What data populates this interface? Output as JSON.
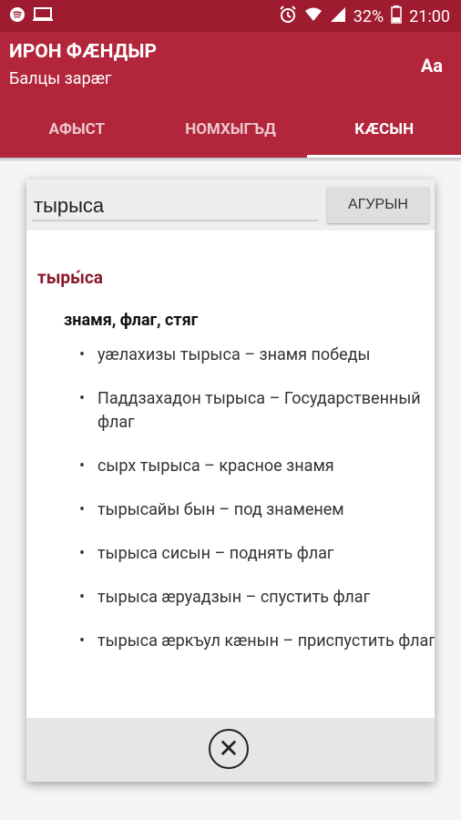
{
  "status": {
    "left_icons": [
      "spotify-icon",
      "screen-cast-icon"
    ],
    "right_icons": [
      "alarm-icon",
      "wifi-icon",
      "signal-icon",
      "battery-icon"
    ],
    "battery": "32%",
    "time": "21:00"
  },
  "app": {
    "title": "ИРОН ФÆНДЫР",
    "subtitle": "Балцы зарæг",
    "font_button": "Aa"
  },
  "tabs": [
    {
      "label": "АФЫСТ"
    },
    {
      "label": "НОМХЫГЪД"
    },
    {
      "label": "КÆСЫН"
    }
  ],
  "dialog": {
    "search_value": "тырыса",
    "search_button": "АГУРЫН",
    "headword": "тыры́са",
    "meaning": "знамя, флаг, стяг",
    "examples": [
      "уæлахизы тырыса – знамя победы",
      "Паддзахадон тырыса – Государственный флаг",
      "сырх тырыса – красное знамя",
      "тырысайы бын – под знаменем",
      "тырыса сисын – поднять флаг",
      "тырыса æруадзын – спустить флаг",
      "тырыса æркъул кæнын – приспустить флаг"
    ]
  },
  "colors": {
    "status_bar": "#9e1b30",
    "app_bar": "#b2253b",
    "headword": "#8b1a2b"
  }
}
